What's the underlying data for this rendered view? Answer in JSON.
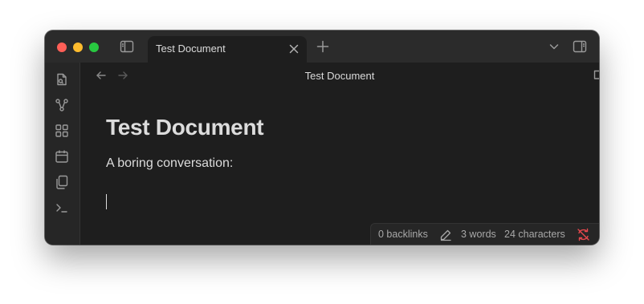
{
  "window": {
    "traffic_lights": [
      "close",
      "minimize",
      "zoom"
    ]
  },
  "tab": {
    "title": "Test Document"
  },
  "view_header": {
    "title": "Test Document"
  },
  "document": {
    "heading": "Test Document",
    "paragraph": "A boring conversation:"
  },
  "sidebar": {
    "icons": [
      "open-quick-switcher-icon",
      "graph-view-icon",
      "canvas-icon",
      "daily-note-icon",
      "templates-icon",
      "command-palette-icon"
    ]
  },
  "status_bar": {
    "backlinks": "0 backlinks",
    "words": "3 words",
    "characters": "24 characters",
    "sync_color": "#e5484d"
  },
  "colors": {
    "background": "#1e1e1e",
    "titlebar": "#2b2b2b",
    "text": "#dcdcdc",
    "muted": "#9a9a9a"
  }
}
